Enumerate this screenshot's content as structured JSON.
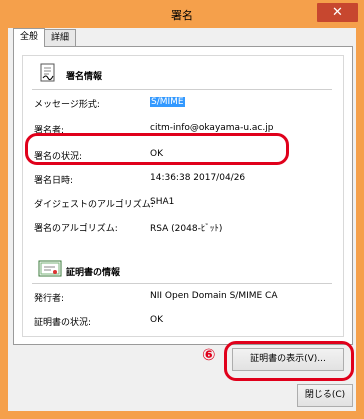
{
  "window": {
    "title": "署名",
    "close_glyph": "✕"
  },
  "tabs": [
    {
      "label": "全般"
    },
    {
      "label": "詳細"
    }
  ],
  "signature_section": {
    "title": "署名情報",
    "icon": "document-signature-icon",
    "rows": [
      {
        "label": "メッセージ形式:",
        "value": "S/MIME"
      },
      {
        "label": "署名者:",
        "value": "citm-info@okayama-u.ac.jp"
      },
      {
        "label": "署名の状況:",
        "value": "OK"
      },
      {
        "label": "署名日時:",
        "value": "14:36:38 2017/04/26"
      },
      {
        "label": "ダイジェストのアルゴリズム:",
        "value": "SHA1"
      },
      {
        "label": "署名のアルゴリズム:",
        "value": "RSA (2048-ﾋﾞｯﾄ)"
      }
    ]
  },
  "certificate_section": {
    "title": "証明書の情報",
    "icon": "certificate-icon",
    "rows": [
      {
        "label": "発行者:",
        "value": "NII Open Domain S/MIME CA"
      },
      {
        "label": "証明書の状況:",
        "value": "OK"
      }
    ]
  },
  "annotation_badge": "⑥",
  "buttons": {
    "view_cert": "証明書の表示(V)...",
    "close": "閉じる(C)"
  },
  "colors": {
    "frame": "#f5a04b",
    "annotation": "#e0001b",
    "selection": "#3399ff",
    "close_button": "#c7472f"
  }
}
